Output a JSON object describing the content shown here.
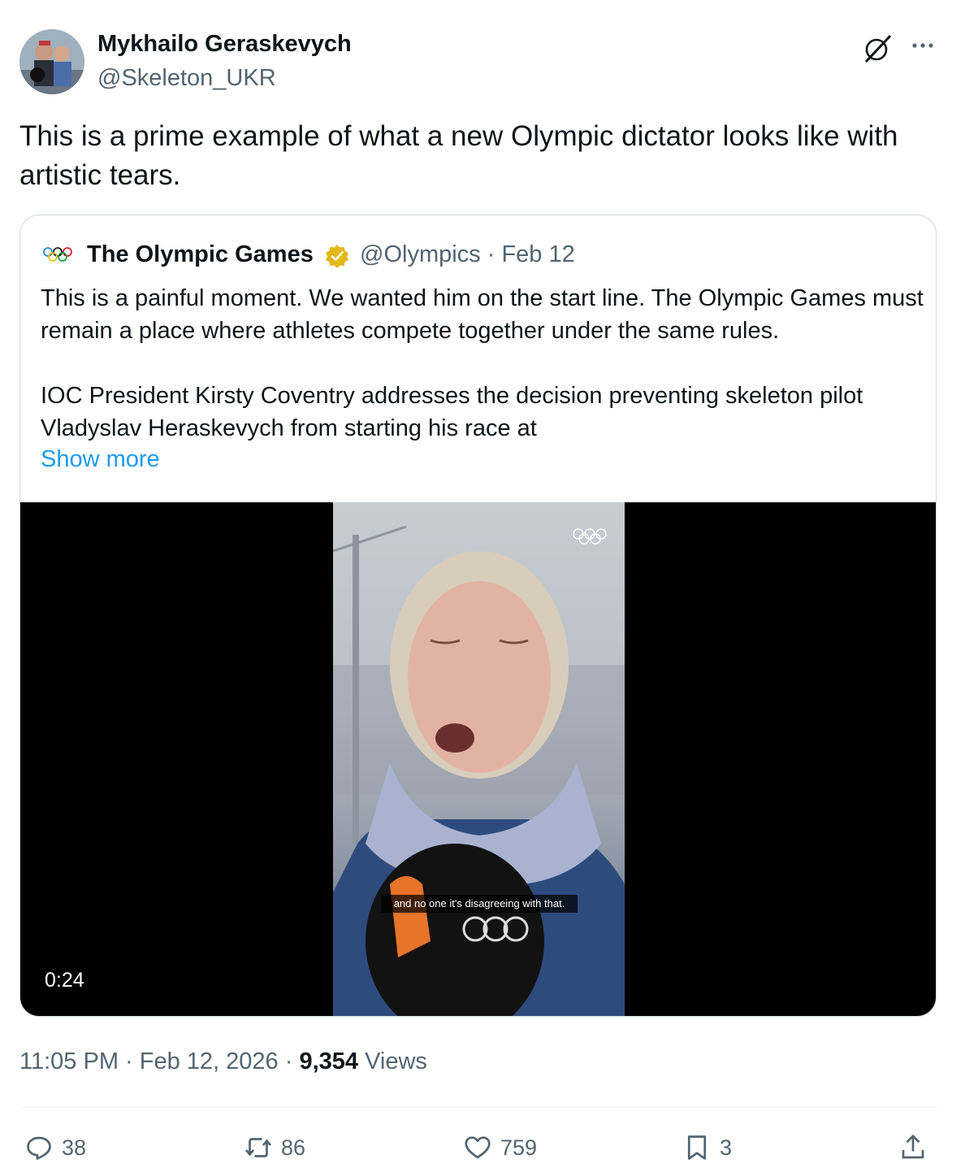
{
  "author": {
    "name": "Mykhailo Geraskevych",
    "handle": "@Skeleton_UKR",
    "avatar_icon": "avatar-photo"
  },
  "tweet": {
    "text": "This is a prime example of what a new Olympic dictator looks like with artistic tears."
  },
  "quote": {
    "name": "The Olympic Games",
    "verified_badge": "gold-verified-badge",
    "handle": "@Olympics",
    "separator": "·",
    "date": "Feb 12",
    "paragraph1": "This is a painful moment. We wanted him on the start line. The Olympic Games must remain a place where athletes compete together under the same rules.",
    "paragraph2": "IOC President Kirsty Coventry addresses the decision preventing skeleton pilot Vladyslav Heraskevych from starting his race at",
    "show_more": "Show more",
    "video": {
      "caption": "and no one it's disagreeing with that.",
      "duration": "0:24"
    }
  },
  "meta": {
    "time": "11:05 PM",
    "sep1": " · ",
    "date": "Feb 12, 2026",
    "sep2": " · ",
    "views_count": "9,354",
    "views_label": " Views"
  },
  "actions": {
    "replies": "38",
    "reposts": "86",
    "likes": "759",
    "bookmarks": "3"
  },
  "colors": {
    "text": "#0f1419",
    "secondary": "#536471",
    "link": "#1d9bf0",
    "border": "#cfd9de"
  }
}
